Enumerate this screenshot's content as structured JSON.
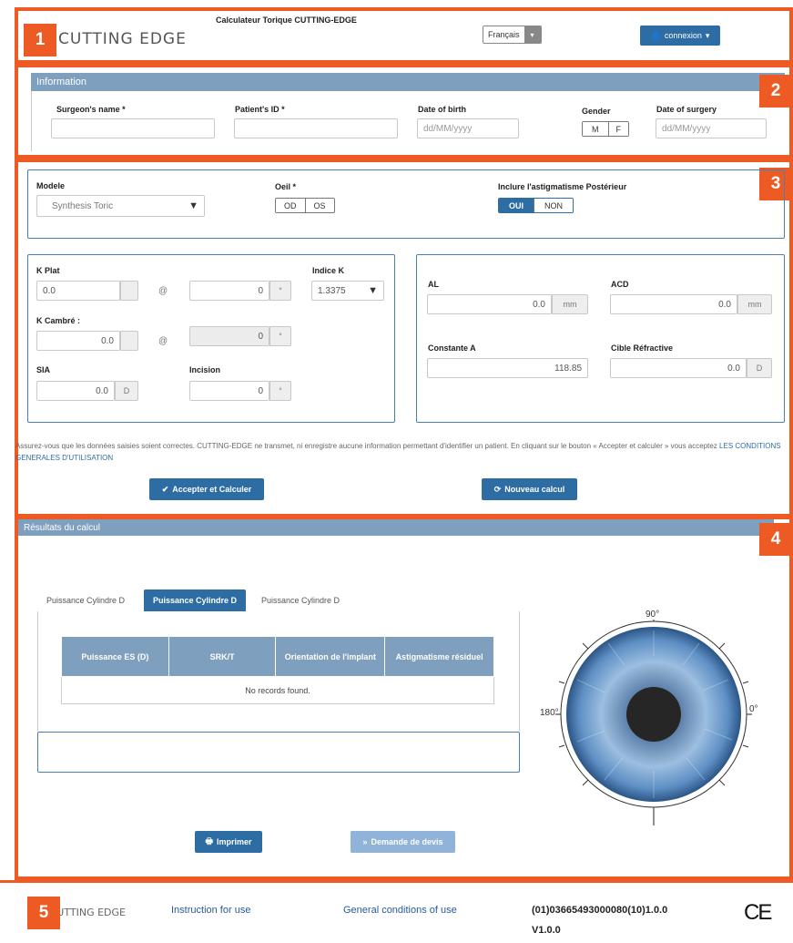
{
  "header": {
    "logo_text": "CUTTING EDGE",
    "app_title": "Calculateur Torique CUTTING-EDGE",
    "language_selected": "Français",
    "connexion_label": "connexion"
  },
  "badges": [
    "1",
    "2",
    "3",
    "4",
    "5"
  ],
  "information": {
    "title": "Information",
    "surgeon_label": "Surgeon's name *",
    "patient_label": "Patient's ID *",
    "dob_label": "Date of birth",
    "dob_placeholder": "dd/MM/yyyy",
    "gender_label": "Gender",
    "gender_m": "M",
    "gender_f": "F",
    "surgery_label": "Date of surgery",
    "surgery_placeholder": "dd/MM/yyyy"
  },
  "model": {
    "modele_label": "Modele",
    "modele_value": "Synthesis Toric",
    "oeil_label": "Oeil *",
    "oeil_od": "OD",
    "oeil_os": "OS",
    "astig_label": "Inclure l'astigmatisme Postérieur",
    "astig_oui": "OUI",
    "astig_non": "NON"
  },
  "keratometry": {
    "kplat_label": "K Plat",
    "kplat_value": "0.0",
    "kplat_axis": "0",
    "at_symbol": "@",
    "indice_label": "Indice K",
    "indice_value": "1.3375",
    "kcambre_label": "K Cambré :",
    "kcambre_value": "0.0",
    "kcambre_axis": "0",
    "sia_label": "SIA",
    "sia_value": "0.0",
    "sia_unit": "D",
    "incision_label": "Incision",
    "incision_value": "0",
    "degree_unit": "°"
  },
  "biometry": {
    "al_label": "AL",
    "al_value": "0.0",
    "acd_label": "ACD",
    "acd_value": "0.0",
    "mm_unit": "mm",
    "constante_label": "Constante A",
    "constante_value": "118.85",
    "cible_label": "Cible Réfractive",
    "cible_value": "0.0",
    "d_unit": "D"
  },
  "disclaimer": {
    "text": "Assurez-vous que les données saisies soient correctes. CUTTING-EDGE ne transmet, ni enregistre aucune information permettant d'identifier un patient. En cliquant sur le bouton « Accepter et calculer » vous acceptez",
    "link": "LES CONDITIONS GENERALES D'UTILISATION"
  },
  "actions": {
    "accept_label": "Accepter et Calculer",
    "new_label": "Nouveau calcul"
  },
  "results": {
    "title": "Résultats du calcul",
    "tabs": [
      "Puissance Cylindre D",
      "Puissance Cylindre D",
      "Puissance Cylindre D"
    ],
    "columns": [
      "Puissance ES (D)",
      "SRK/T",
      "Orientation de l'implant",
      "Astigmatisme résiduel"
    ],
    "empty_message": "No records found.",
    "angle_top": "90°",
    "angle_left": "180°",
    "angle_right": "0°",
    "print_label": "Imprimer",
    "quote_label": "Demande de devis"
  },
  "footer": {
    "logo_text": "CUTTING EDGE",
    "ifu_link": "Instruction for use",
    "conditions_link": "General conditions of use",
    "udi": "(01)03665493000080(10)1.0.0",
    "version": "V1.0.0",
    "ce_mark": "CE"
  },
  "colors": {
    "frame": "#ee5a24",
    "primary": "#2d6da3",
    "header_bar": "#7f9fbf"
  }
}
